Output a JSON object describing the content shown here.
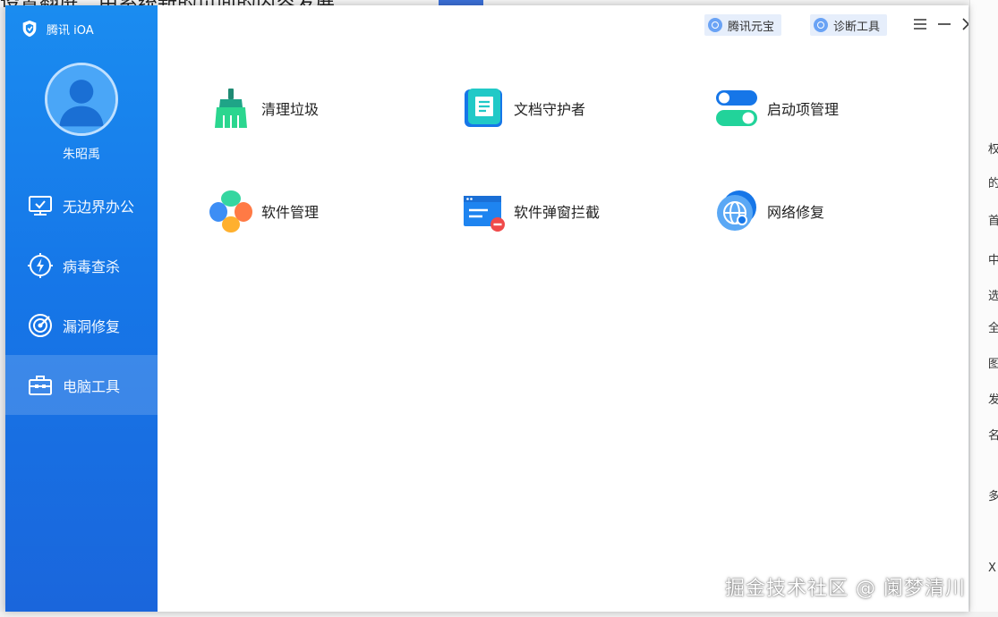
{
  "background": {
    "top_text": "设置翻屏：由系统新的页面的内容发展",
    "right_chars": [
      "权",
      "的",
      "首",
      "中",
      "选",
      "全",
      "图",
      "发",
      "名",
      "多",
      "X"
    ]
  },
  "sidebar": {
    "app_name": "腾讯 iOA",
    "username": "朱昭禹",
    "items": [
      {
        "label": "无边界办公",
        "icon": "monitor-check-icon",
        "active": false
      },
      {
        "label": "病毒查杀",
        "icon": "shield-bolt-icon",
        "active": false
      },
      {
        "label": "漏洞修复",
        "icon": "target-icon",
        "active": false
      },
      {
        "label": "电脑工具",
        "icon": "toolbox-icon",
        "active": true
      }
    ]
  },
  "header": {
    "yuanbao_label": "腾讯元宝",
    "diagnose_label": "诊断工具",
    "controls": [
      "menu-icon",
      "minimize-icon",
      "close-icon"
    ]
  },
  "tools": [
    {
      "label": "清理垃圾",
      "icon": "broom-icon"
    },
    {
      "label": "文档守护者",
      "icon": "document-icon"
    },
    {
      "label": "启动项管理",
      "icon": "toggle-icon"
    },
    {
      "label": "软件管理",
      "icon": "clover-icon"
    },
    {
      "label": "软件弹窗拦截",
      "icon": "popup-block-icon"
    },
    {
      "label": "网络修复",
      "icon": "globe-wrench-icon"
    }
  ],
  "colors": {
    "sidebar": "#1677e8",
    "accent": "#1a8cf0",
    "green": "#25d28a"
  },
  "watermark": "掘金技术社区 @ 阑梦清川"
}
